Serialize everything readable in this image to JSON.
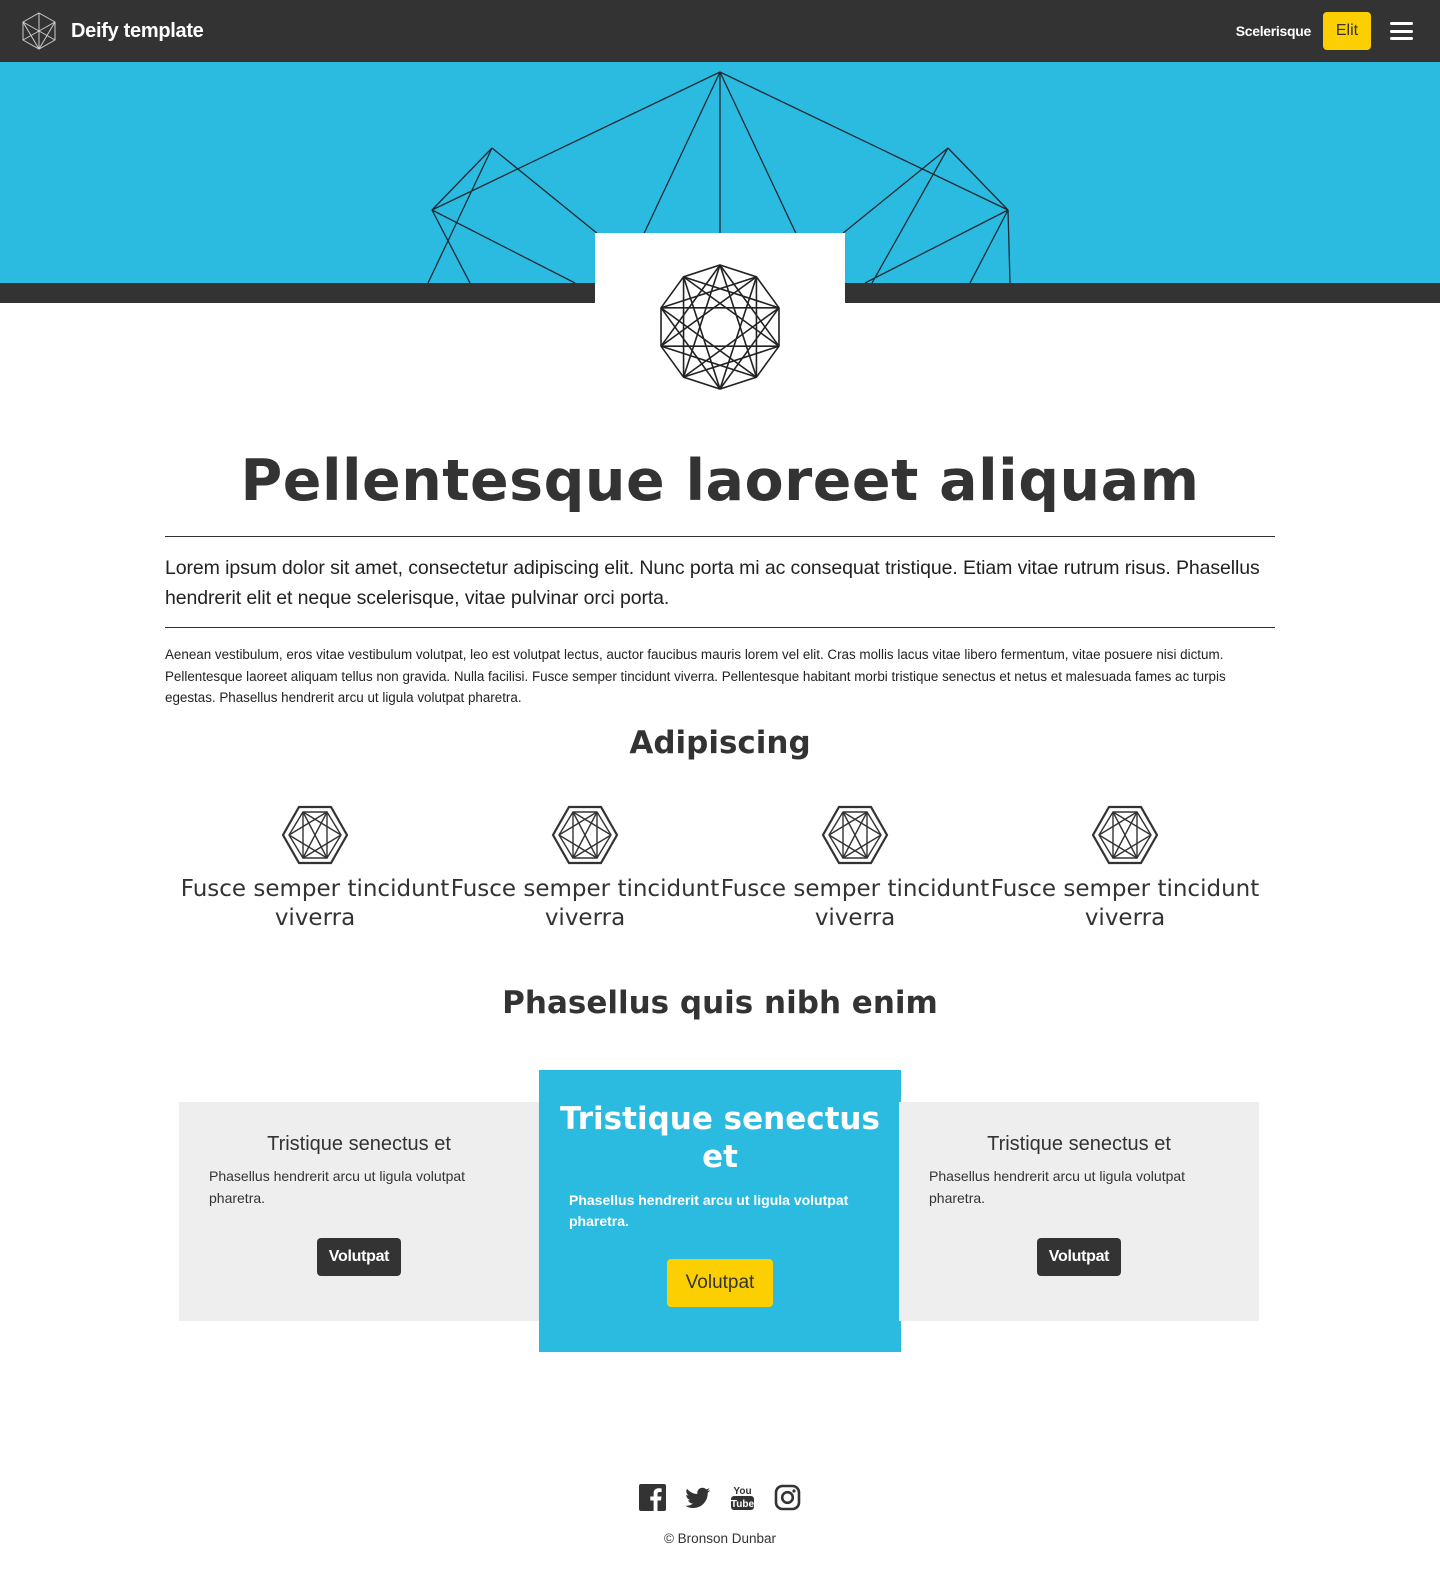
{
  "navbar": {
    "brand_title": "Deify template",
    "link_label": "Scelerisque",
    "button_label": "Elit",
    "menu_icon": "hamburger-menu-icon"
  },
  "colors": {
    "dark": "#333333",
    "accent_blue": "#2bbbe0",
    "accent_yellow": "#fcd000",
    "card_gray": "#eeeeee"
  },
  "main": {
    "title": "Pellentesque laoreet aliquam",
    "lead": "Lorem ipsum dolor sit amet, consectetur adipiscing elit. Nunc porta mi ac consequat tristique. Etiam vitae rutrum risus. Phasellus hendrerit elit et neque scelerisque, vitae pulvinar orci porta.",
    "body": "Aenean vestibulum, eros vitae vestibulum volutpat, leo est volutpat lectus, auctor faucibus mauris lorem vel elit. Cras mollis lacus vitae libero fermentum, vitae posuere nisi dictum. Pellentesque laoreet aliquam tellus non gravida. Nulla facilisi. Fusce semper tincidunt viverra. Pellentesque habitant morbi tristique senectus et netus et malesuada fames ac turpis egestas. Phasellus hendrerit arcu ut ligula volutpat pharetra."
  },
  "features": {
    "heading": "Adipiscing",
    "items": [
      {
        "label": "Fusce semper tincidunt viverra",
        "icon": "geometric-hexagon-icon"
      },
      {
        "label": "Fusce semper tincidunt viverra",
        "icon": "geometric-hexagon-icon"
      },
      {
        "label": "Fusce semper tincidunt viverra",
        "icon": "geometric-hexagon-icon"
      },
      {
        "label": "Fusce semper tincidunt viverra",
        "icon": "geometric-hexagon-icon"
      }
    ]
  },
  "pricing": {
    "heading": "Phasellus quis nibh enim",
    "cards": [
      {
        "title": "Tristique senectus et",
        "text": "Phasellus hendrerit arcu ut ligula volutpat pharetra.",
        "button": "Volutpat"
      },
      {
        "title": "Tristique senectus et",
        "text": "Phasellus hendrerit arcu ut ligula volutpat pharetra.",
        "button": "Volutpat"
      },
      {
        "title": "Tristique senectus et",
        "text": "Phasellus hendrerit arcu ut ligula volutpat pharetra.",
        "button": "Volutpat"
      }
    ]
  },
  "footer": {
    "social": [
      "facebook-icon",
      "twitter-icon",
      "youtube-icon",
      "instagram-icon"
    ],
    "copyright": "© Bronson Dunbar"
  }
}
